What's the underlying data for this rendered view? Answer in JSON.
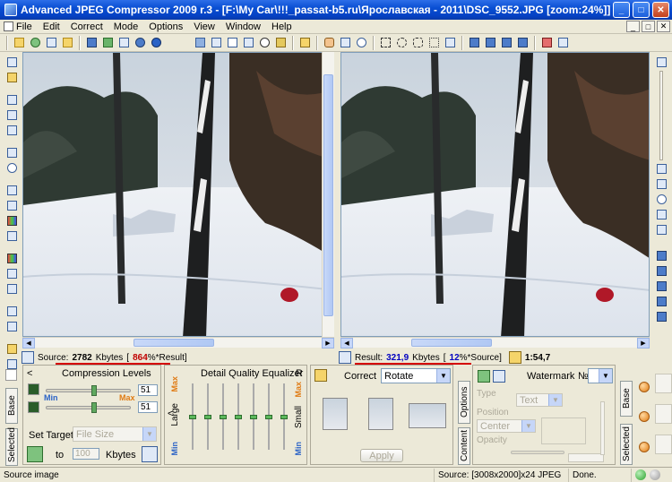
{
  "window": {
    "title": "Advanced JPEG Compressor 2009 r.3 - [F:\\My Car\\!!!_passat-b5.ru\\Ярославская - 2011\\DSC_9552.JPG  [zoom:24%]]",
    "minimize": "_",
    "maximize": "□",
    "close": "✕"
  },
  "menu": {
    "items": [
      "File",
      "Edit",
      "Correct",
      "Mode",
      "Options",
      "View",
      "Window",
      "Help"
    ]
  },
  "source_info": {
    "label": "Source:",
    "size": "2782",
    "unit": "Kbytes",
    "bracket_open": "[",
    "percent": "864",
    "suffix": "%*Result]"
  },
  "result_info": {
    "label": "Result:",
    "size": "321,9",
    "unit": "Kbytes",
    "bracket_open": "[",
    "percent": "12",
    "suffix": "%*Source]",
    "ratio": "1:54,7"
  },
  "compression": {
    "title": "Compression Levels",
    "back": "<",
    "value1": "51",
    "value2": "51",
    "min_label": "Min",
    "max_label": "Max",
    "knob1": 0.56,
    "knob2": 0.56,
    "set_target_label": "Set Target",
    "target_option": "File Size",
    "to_label": "to",
    "target_value": "100",
    "kbytes_label": "Kbytes"
  },
  "equalizer": {
    "title": "Detail Quality Equalizer",
    "r_label": "R",
    "max_label": "Max",
    "min_label": "Min",
    "large_label": "Large",
    "small_label": "Small",
    "back": "<",
    "levels": [
      0.5,
      0.5,
      0.5,
      0.5,
      0.5,
      0.5,
      0.5
    ]
  },
  "correct": {
    "label": "Correct",
    "option": "Rotate",
    "apply": "Apply"
  },
  "watermark": {
    "label": "Watermark",
    "number_label": "№",
    "type_label": "Type",
    "type_value": "Text",
    "position_label": "Position",
    "position_value": "Center",
    "opacity_label": "Opacity"
  },
  "side_tabs": {
    "base": "Base",
    "selected": "Selected",
    "options": "Options",
    "content": "Content",
    "base_right": "Base",
    "selected_right": "Selected"
  },
  "status": {
    "left": "Source image",
    "middle": "Source: [3008x2000]x24 JPEG",
    "right": "Done."
  },
  "colors": {
    "title_bar": "#0a4fd3",
    "highlight_red": "#c00000",
    "highlight_blue": "#0000c0",
    "underline_red": "#d40000"
  }
}
